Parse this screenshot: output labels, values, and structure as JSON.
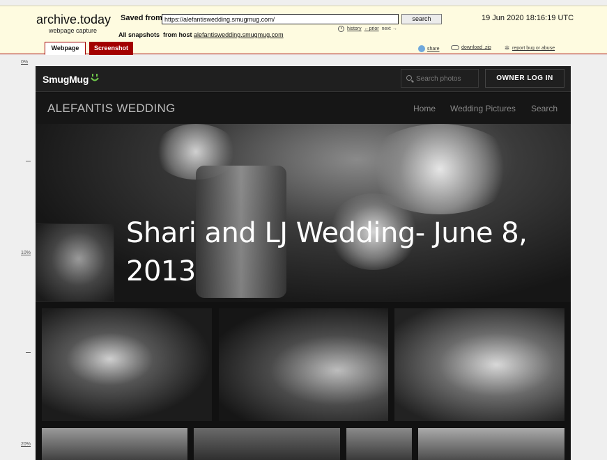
{
  "archive": {
    "logo": "archive.today",
    "subtitle": "webpage capture",
    "saved_from_label": "Saved from",
    "url_value": "https://alefantiswedding.smugmug.com/",
    "search_label": "search",
    "history_label": "history",
    "prior_label": "←prior",
    "next_label": "next →",
    "date": "19 Jun 2020 18:16:19 UTC",
    "snapshots_label": "All snapshots",
    "from_host_label": "from host",
    "host_link": "alefantiswedding.smugmug.com",
    "tabs": {
      "webpage": "Webpage",
      "screenshot": "Screenshot"
    },
    "share_label": "share",
    "download_label": "download .zip",
    "report_label": "report bug or abuse"
  },
  "ruler": {
    "m0": "0%",
    "m10": "10%",
    "m20": "20%"
  },
  "smugmug": {
    "logo": "SmugMug",
    "search_placeholder": "Search photos",
    "owner_login": "OWNER LOG IN",
    "site_title": "ALEFANTIS WEDDING",
    "nav": {
      "home": "Home",
      "wedding_pictures": "Wedding Pictures",
      "search": "Search"
    },
    "hero_title": "Shari and LJ Wedding- June 8, 2013"
  },
  "colors": {
    "archive_bg": "#fefbe0",
    "archive_accent": "#a30000",
    "smug_bg": "#111111",
    "smug_green": "#6fc94a"
  }
}
